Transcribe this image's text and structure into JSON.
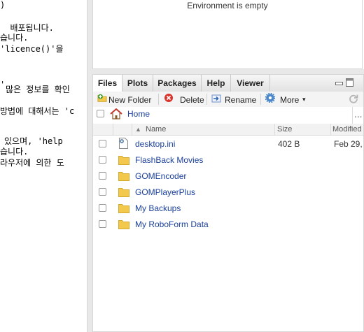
{
  "console": {
    "lines": [
      ")",
      "",
      "  배포됩니다.",
      "습니다.",
      "'licence()'을",
      "",
      "",
      "",
      "많은 정보를 확인",
      "",
      "방법에 대해서는 'c",
      "",
      "",
      "있으며, 'help",
      "습니다.",
      "라우저에 의한 도"
    ]
  },
  "environment": {
    "empty_text": "Environment is empty"
  },
  "tabs": [
    {
      "label": "Files",
      "active": true
    },
    {
      "label": "Plots",
      "active": false
    },
    {
      "label": "Packages",
      "active": false
    },
    {
      "label": "Help",
      "active": false
    },
    {
      "label": "Viewer",
      "active": false
    }
  ],
  "toolbar": {
    "new_folder": "New Folder",
    "delete": "Delete",
    "rename": "Rename",
    "more": "More"
  },
  "path": {
    "home": "Home",
    "ellipsis": "..."
  },
  "columns": {
    "name": "Name",
    "size": "Size",
    "modified": "Modified"
  },
  "files": [
    {
      "name": "desktop.ini",
      "type": "file",
      "size": "402 B",
      "modified": "Feb 29,"
    },
    {
      "name": "FlashBack Movies",
      "type": "folder",
      "size": "",
      "modified": ""
    },
    {
      "name": "GOMEncoder",
      "type": "folder",
      "size": "",
      "modified": ""
    },
    {
      "name": "GOMPlayerPlus",
      "type": "folder",
      "size": "",
      "modified": ""
    },
    {
      "name": "My Backups",
      "type": "folder",
      "size": "",
      "modified": ""
    },
    {
      "name": "My RoboForm Data",
      "type": "folder",
      "size": "",
      "modified": ""
    }
  ],
  "colors": {
    "folder": "#f2c94c",
    "link": "#1a3f9c",
    "delete_red": "#d9352c",
    "new_folder_green": "#3f9b2e"
  }
}
